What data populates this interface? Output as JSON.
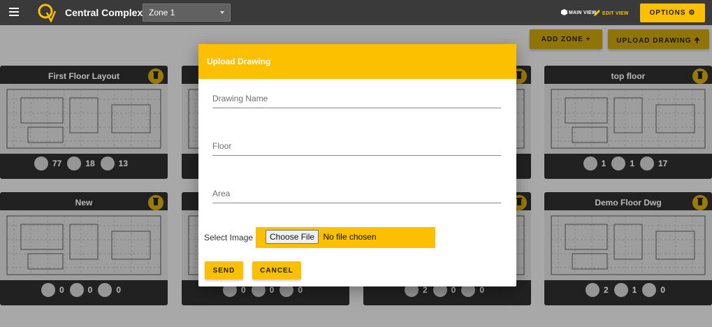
{
  "header": {
    "app_title": "Central Complex",
    "zone_select_value": "Zone 1",
    "main_view_label": "MAIN VIEW",
    "edit_view_label": "EDIT VIEW",
    "options_label": "OPTIONS"
  },
  "toolbar": {
    "add_zone_label": "ADD ZONE +",
    "upload_drawing_label": "UPLOAD DRAWING"
  },
  "drawings": [
    {
      "title": "First Floor Layout",
      "markers": "77",
      "photos": "18",
      "videos": "13"
    },
    {
      "title": "",
      "markers": "",
      "photos": "",
      "videos": ""
    },
    {
      "title": "",
      "markers": "",
      "photos": "",
      "videos": ""
    },
    {
      "title": "top floor",
      "markers": "1",
      "photos": "1",
      "videos": "17"
    },
    {
      "title": "New",
      "markers": "0",
      "photos": "0",
      "videos": "0"
    },
    {
      "title": "",
      "markers": "0",
      "photos": "0",
      "videos": "0"
    },
    {
      "title": "",
      "markers": "2",
      "photos": "0",
      "videos": "0"
    },
    {
      "title": "Demo Floor Dwg",
      "markers": "2",
      "photos": "1",
      "videos": "0"
    }
  ],
  "modal": {
    "title": "Upload Drawing",
    "drawing_name_placeholder": "Drawing Name",
    "floor_placeholder": "Floor",
    "area_placeholder": "Area",
    "select_image_label": "Select Image",
    "choose_file_label": "Choose File",
    "no_file_label": "No file chosen",
    "send_label": "SEND",
    "cancel_label": "CANCEL"
  },
  "colors": {
    "accent": "#fcc000",
    "topbar": "#3a3a3a",
    "card_bg": "#2f2f2f"
  }
}
